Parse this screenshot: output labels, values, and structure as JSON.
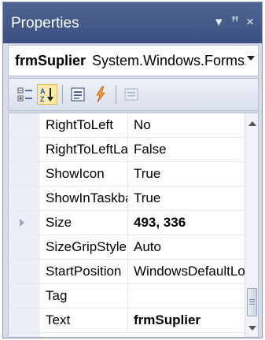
{
  "title": "Properties",
  "title_controls": {
    "dropdown": "▾",
    "pin": "ꟸ",
    "close": "×"
  },
  "object_selector": {
    "name": "frmSuplier",
    "type": "System.Windows.Forms.Form"
  },
  "toolbar": {
    "buttons": [
      {
        "name": "categorized-icon",
        "active": false
      },
      {
        "name": "alphabetical-icon",
        "active": true
      },
      {
        "name": "properties-icon",
        "active": false
      },
      {
        "name": "events-icon",
        "active": false
      },
      {
        "name": "property-pages-icon",
        "active": false,
        "disabled": true
      }
    ]
  },
  "properties": [
    {
      "name": "RightToLeft",
      "value": "No",
      "bold": false,
      "expandable": false
    },
    {
      "name": "RightToLeftLayout",
      "value": "False",
      "bold": false,
      "expandable": false
    },
    {
      "name": "ShowIcon",
      "value": "True",
      "bold": false,
      "expandable": false
    },
    {
      "name": "ShowInTaskbar",
      "value": "True",
      "bold": false,
      "expandable": false
    },
    {
      "name": "Size",
      "value": "493, 336",
      "bold": true,
      "expandable": true
    },
    {
      "name": "SizeGripStyle",
      "value": "Auto",
      "bold": false,
      "expandable": false
    },
    {
      "name": "StartPosition",
      "value": "WindowsDefaultLocation",
      "bold": false,
      "expandable": false
    },
    {
      "name": "Tag",
      "value": "",
      "bold": false,
      "expandable": false
    },
    {
      "name": "Text",
      "value": "frmSuplier",
      "bold": true,
      "expandable": false
    }
  ],
  "colors": {
    "title_bar": "#4a5f8f",
    "active_button": "#fbe9a9",
    "panel_background": "#d6dbe9"
  }
}
